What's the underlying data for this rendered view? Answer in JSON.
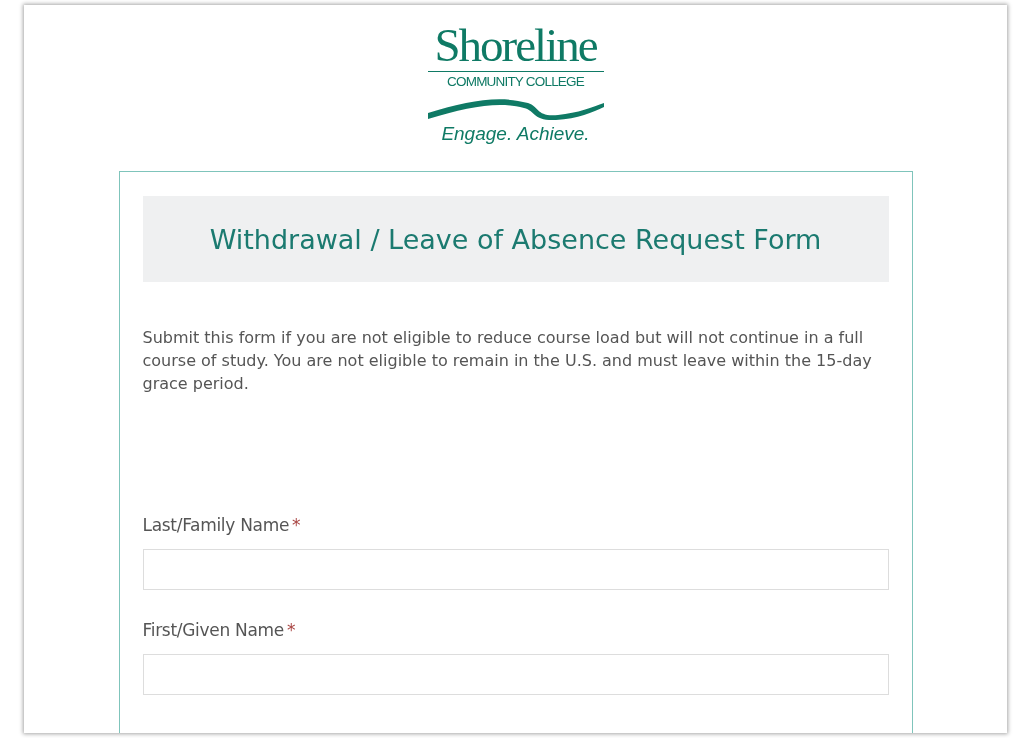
{
  "logo": {
    "name": "Shoreline",
    "subtitle": "COMMUNITY COLLEGE",
    "tagline": "Engage. Achieve."
  },
  "form": {
    "title": "Withdrawal / Leave of Absence Request Form",
    "intro": "Submit this form if you are not eligible to reduce course load but  will not continue in a full course of study. You are not eligible to remain in the U.S. and must leave within the 15-day grace period.",
    "fields": [
      {
        "label": "Last/Family Name",
        "required": true,
        "required_mark": "*"
      },
      {
        "label": "First/Given Name",
        "required": true,
        "required_mark": "*"
      }
    ]
  }
}
